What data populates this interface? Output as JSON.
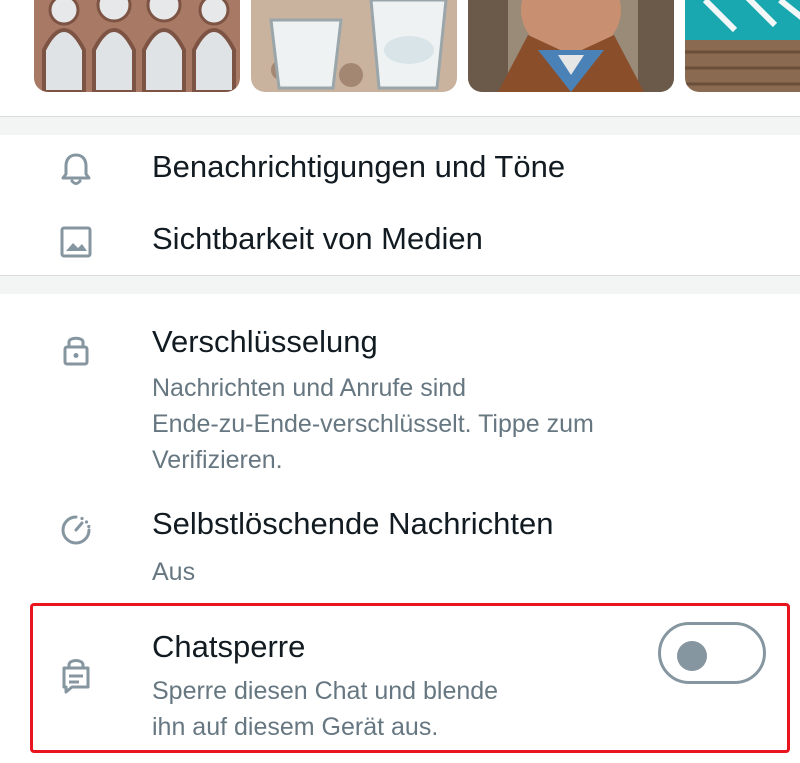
{
  "media": {
    "thumbnails": [
      {
        "icon": "rose-window-photo"
      },
      {
        "icon": "glasses-photo"
      },
      {
        "icon": "person-photo"
      },
      {
        "icon": "graffiti-wall-photo"
      }
    ]
  },
  "settings": {
    "notifications": {
      "title": "Benachrichtigungen und Töne",
      "icon": "bell-icon"
    },
    "media_visibility": {
      "title": "Sichtbarkeit von Medien",
      "icon": "image-icon"
    },
    "encryption": {
      "title": "Verschlüsselung",
      "subtitle_lines": [
        "Nachrichten und Anrufe sind",
        "Ende-zu-Ende-verschlüsselt. Tippe zum",
        "Verifizieren."
      ],
      "icon": "lock-icon"
    },
    "disappearing": {
      "title": "Selbstlöschende Nachrichten",
      "value": "Aus",
      "icon": "timer-icon"
    },
    "chat_lock": {
      "title": "Chatsperre",
      "subtitle_lines": [
        "Sperre diesen Chat und blende",
        "ihn auf diesem Gerät aus."
      ],
      "icon": "chat-lock-icon",
      "enabled": false
    }
  },
  "colors": {
    "highlight": "#e8141e",
    "icon": "#8696a0",
    "subtitle": "#667781",
    "text": "#111b21"
  }
}
